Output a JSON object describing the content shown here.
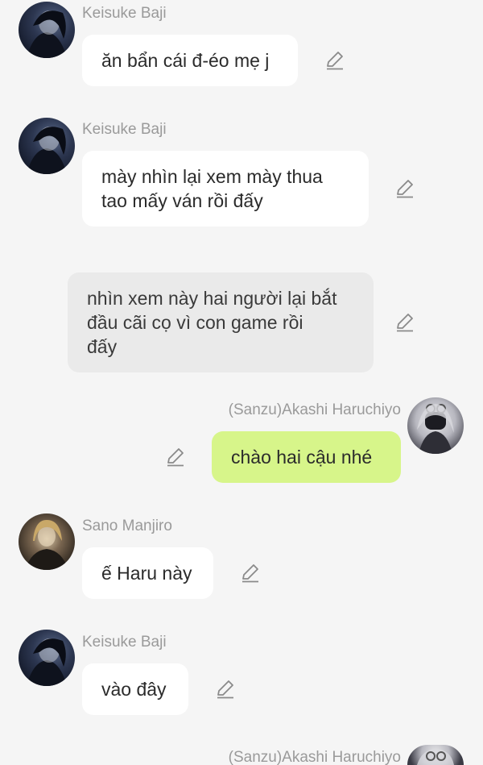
{
  "messages": [
    {
      "sender": "Keisuke Baji",
      "lines": [
        "ăn bẩn cái đ-éo mẹ j"
      ]
    },
    {
      "sender": "Keisuke Baji",
      "lines": [
        "mày nhìn lại xem mày thua",
        "tao mấy ván rồi đấy"
      ]
    },
    {
      "sender": "",
      "lines": [
        "nhìn xem này hai người lại bắt",
        "đầu cãi cọ vì con game rồi",
        "đấy"
      ]
    },
    {
      "sender": "(Sanzu)Akashi Haruchiyo",
      "lines": [
        "chào hai cậu nhé"
      ]
    },
    {
      "sender": "Sano Manjiro",
      "lines": [
        "ế Haru này"
      ]
    },
    {
      "sender": "Keisuke Baji",
      "lines": [
        "vào đây"
      ]
    },
    {
      "sender": "(Sanzu)Akashi Haruchiyo",
      "lines": []
    }
  ],
  "colors": {
    "background": "#f5f5f5",
    "bubble_white": "#ffffff",
    "bubble_gray": "#eaeaea",
    "bubble_green": "#d7f58a",
    "name_text": "#9a9a9a",
    "icon": "#8a8a8a"
  },
  "icons": {
    "edit": "pencil-icon"
  }
}
